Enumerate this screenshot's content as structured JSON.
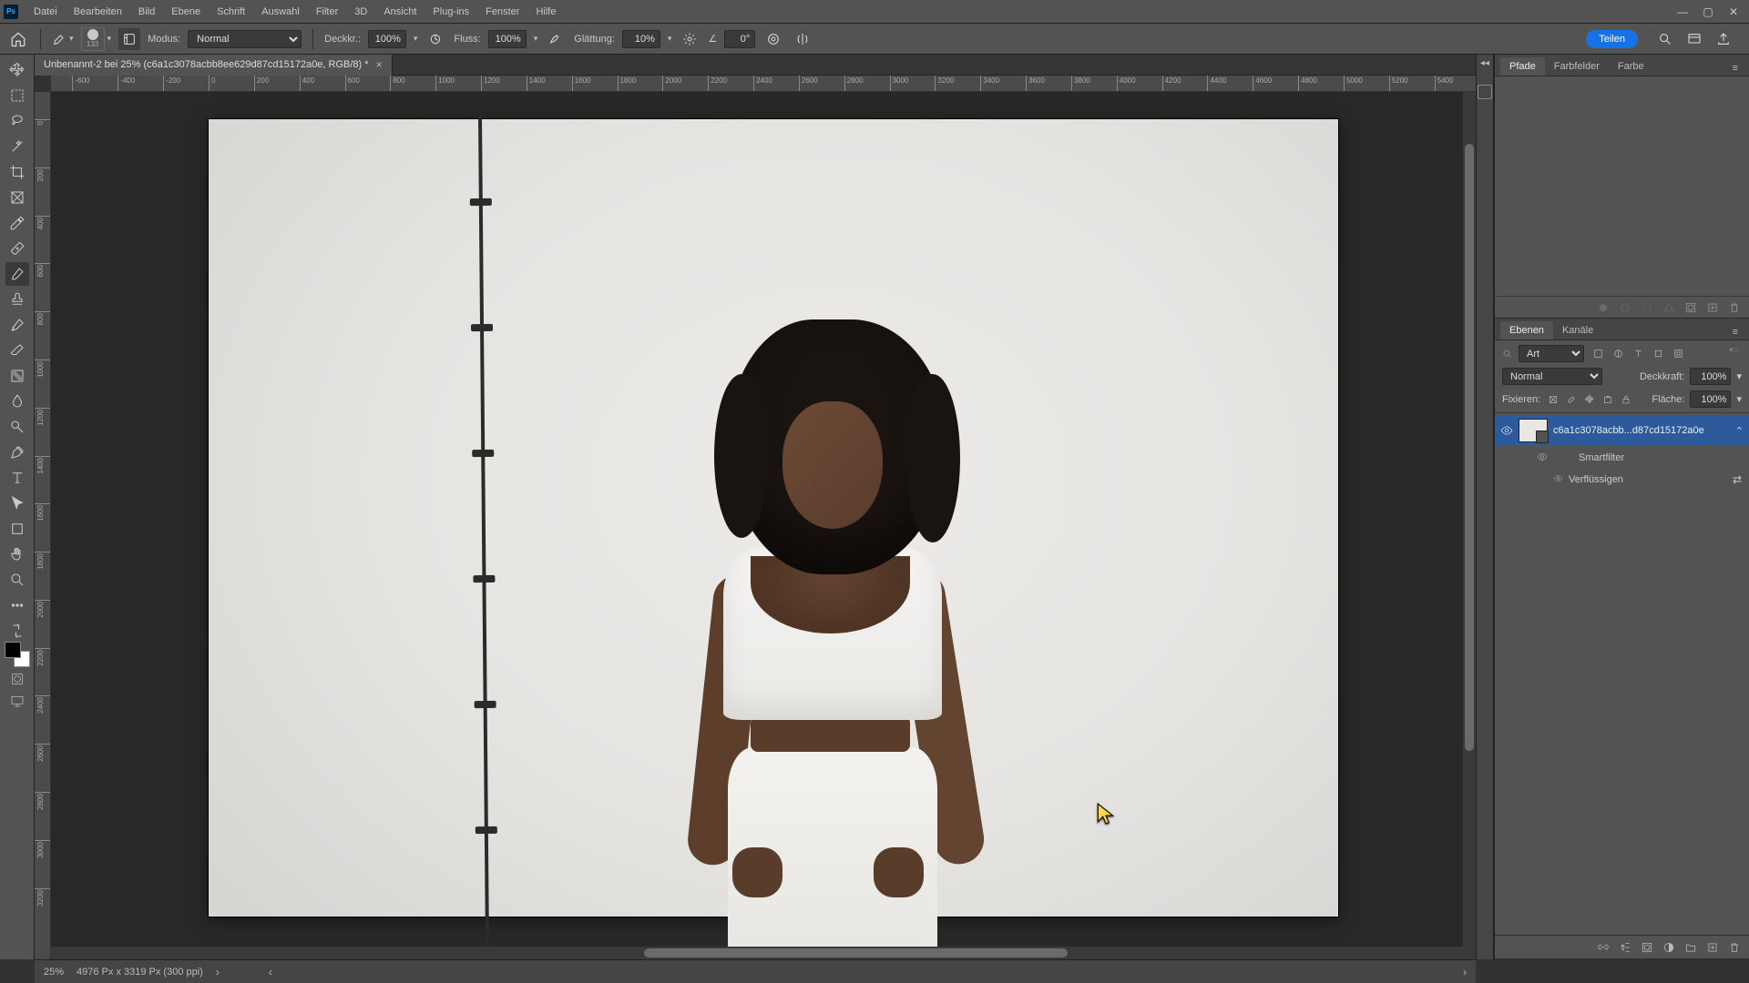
{
  "app": {
    "ps_logo": "Ps"
  },
  "menu": {
    "datei": "Datei",
    "bearbeiten": "Bearbeiten",
    "bild": "Bild",
    "ebene": "Ebene",
    "schrift": "Schrift",
    "auswahl": "Auswahl",
    "filter": "Filter",
    "dd": "3D",
    "ansicht": "Ansicht",
    "plugins": "Plug-ins",
    "fenster": "Fenster",
    "hilfe": "Hilfe"
  },
  "options": {
    "brush_size": "133",
    "modus_label": "Modus:",
    "modus_value": "Normal",
    "deckkraft_label": "Deckkr.:",
    "deckkraft_value": "100%",
    "fluss_label": "Fluss:",
    "fluss_value": "100%",
    "glaettung_label": "Glättung:",
    "glaettung_value": "10%",
    "angle_icon": "∠",
    "angle_value": "0°",
    "share": "Teilen"
  },
  "document": {
    "tab_title": "Unbenannt-2 bei 25% (c6a1c3078acbb8ee629d87cd15172a0e, RGB/8) *",
    "ruler_ticks": [
      "-600",
      "-400",
      "-200",
      "0",
      "200",
      "400",
      "600",
      "800",
      "1000",
      "1200",
      "1400",
      "1600",
      "1800",
      "2000",
      "2200",
      "2400",
      "2600",
      "2800",
      "3000",
      "3200",
      "3400",
      "3600",
      "3800",
      "4000",
      "4200",
      "4400",
      "4600",
      "4800",
      "5000",
      "5200",
      "5400"
    ],
    "ruler_v_ticks": [
      "0",
      "200",
      "400",
      "600",
      "800",
      "1000",
      "1200",
      "1400",
      "1600",
      "1800",
      "2000",
      "2200",
      "2400",
      "2600",
      "2800",
      "3000",
      "3200"
    ]
  },
  "panels": {
    "paths_tabs": {
      "pfade": "Pfade",
      "farbfelder": "Farbfelder",
      "farbe": "Farbe"
    },
    "layers_tabs": {
      "ebenen": "Ebenen",
      "kanaele": "Kanäle"
    },
    "layers": {
      "filter_kind": "Art",
      "blend_mode": "Normal",
      "deckkraft_label": "Deckkraft:",
      "deckkraft_value": "100%",
      "fixieren_label": "Fixieren:",
      "flaeche_label": "Fläche:",
      "flaeche_value": "100%",
      "layer_name": "c6a1c3078acbb...d87cd15172a0e",
      "smartfilter": "Smartfilter",
      "verfluessigen": "Verflüssigen"
    }
  },
  "status": {
    "zoom": "25%",
    "docinfo": "4976 Px x 3319 Px (300 ppi)"
  }
}
